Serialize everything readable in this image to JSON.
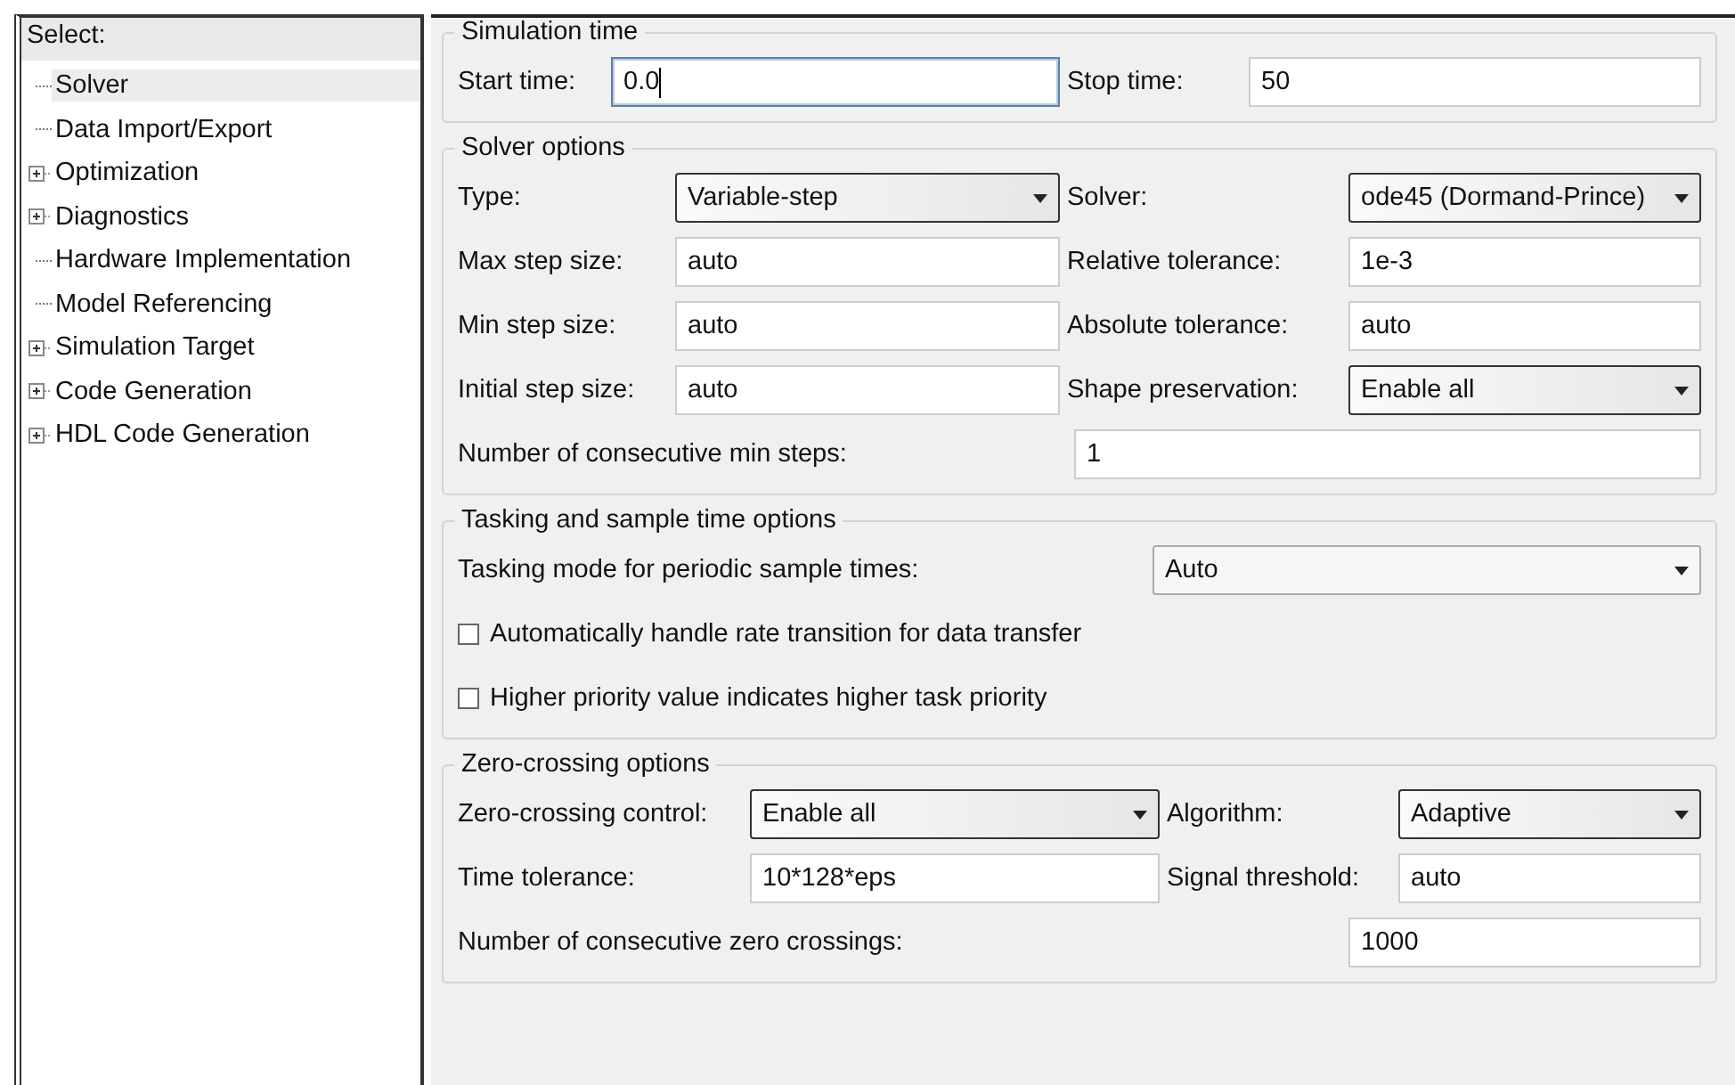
{
  "sidebar": {
    "title": "Select:",
    "items": [
      {
        "label": "Solver",
        "expandable": false,
        "selected": true
      },
      {
        "label": "Data Import/Export",
        "expandable": false,
        "selected": false
      },
      {
        "label": "Optimization",
        "expandable": true,
        "selected": false
      },
      {
        "label": "Diagnostics",
        "expandable": true,
        "selected": false
      },
      {
        "label": "Hardware Implementation",
        "expandable": false,
        "selected": false
      },
      {
        "label": "Model Referencing",
        "expandable": false,
        "selected": false
      },
      {
        "label": "Simulation Target",
        "expandable": true,
        "selected": false
      },
      {
        "label": "Code Generation",
        "expandable": true,
        "selected": false
      },
      {
        "label": "HDL Code Generation",
        "expandable": true,
        "selected": false
      }
    ]
  },
  "sections": [
    {
      "title": "Simulation time",
      "rows": [
        {
          "kind": "pair",
          "cells": [
            {
              "label": "Start time:",
              "value": "0.0",
              "kind": "text",
              "focused": true
            },
            {
              "label": "Stop time:",
              "value": "50",
              "kind": "text",
              "focused": false
            }
          ]
        }
      ]
    },
    {
      "title": "Solver options",
      "rows": [
        {
          "kind": "pair",
          "cells": [
            {
              "label": "Type:",
              "value": "Variable-step",
              "kind": "dropdown"
            },
            {
              "label": "Solver:",
              "value": "ode45 (Dormand-Prince)",
              "kind": "dropdown"
            }
          ]
        },
        {
          "kind": "pair",
          "cells": [
            {
              "label": "Max step size:",
              "value": "auto",
              "kind": "text",
              "focused": false
            },
            {
              "label": "Relative tolerance:",
              "value": "1e-3",
              "kind": "text",
              "focused": false
            }
          ]
        },
        {
          "kind": "pair",
          "cells": [
            {
              "label": "Min step size:",
              "value": "auto",
              "kind": "text",
              "focused": false
            },
            {
              "label": "Absolute tolerance:",
              "value": "auto",
              "kind": "text",
              "focused": false
            }
          ]
        },
        {
          "kind": "pair",
          "cells": [
            {
              "label": "Initial step size:",
              "value": "auto",
              "kind": "text",
              "focused": false
            },
            {
              "label": "Shape preservation:",
              "value": "Enable all",
              "kind": "dropdown"
            }
          ]
        },
        {
          "kind": "wide",
          "cells": [
            {
              "label": "Number of consecutive min steps:",
              "value": "1",
              "kind": "text",
              "focused": false
            }
          ]
        }
      ]
    },
    {
      "title": "Tasking and sample time options",
      "rows": [
        {
          "kind": "wide",
          "cells": [
            {
              "label": "Tasking mode for periodic sample times:",
              "value": "Auto",
              "kind": "dropdown"
            }
          ]
        },
        {
          "kind": "checkbox",
          "label": "Automatically handle rate transition for data transfer",
          "checked": false
        },
        {
          "kind": "checkbox",
          "label": "Higher priority value indicates higher task priority",
          "checked": false
        }
      ]
    },
    {
      "title": "Zero-crossing options",
      "rows": [
        {
          "kind": "pair",
          "cells": [
            {
              "label": "Zero-crossing control:",
              "value": "Enable all",
              "kind": "dropdown"
            },
            {
              "label": "Algorithm:",
              "value": "Adaptive",
              "kind": "dropdown"
            }
          ]
        },
        {
          "kind": "pair",
          "cells": [
            {
              "label": "Time tolerance:",
              "value": "10*128*eps",
              "kind": "text",
              "focused": false
            },
            {
              "label": "Signal threshold:",
              "value": "auto",
              "kind": "text",
              "focused": false
            }
          ]
        },
        {
          "kind": "wide",
          "cells": [
            {
              "label": "Number of consecutive zero crossings:",
              "value": "1000",
              "kind": "text",
              "focused": false
            }
          ]
        }
      ]
    }
  ]
}
